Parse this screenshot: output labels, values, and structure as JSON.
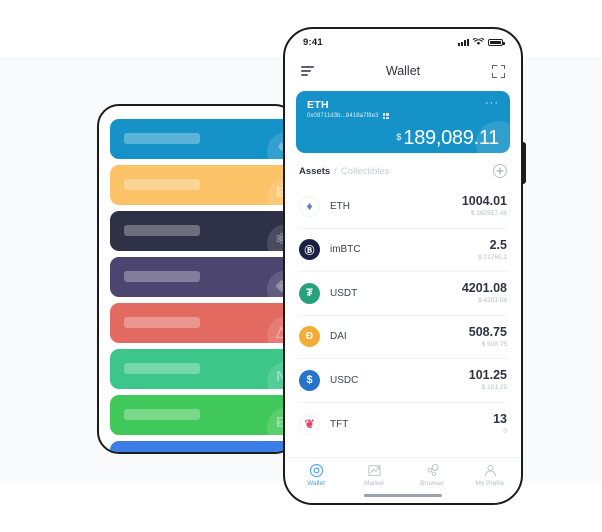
{
  "left_phone": {
    "name": "placeholder-wallet-list",
    "cards": [
      {
        "color": "#1592c8",
        "watermark_icon": "ethereum-icon",
        "glyph": "♦"
      },
      {
        "color": "#fbc267",
        "watermark_icon": "bitcoin-icon",
        "glyph": "Ƀ"
      },
      {
        "color": "#2f3147",
        "watermark_icon": "cosmos-icon",
        "glyph": "⚛"
      },
      {
        "color": "#4c4570",
        "watermark_icon": "eos-icon",
        "glyph": "◈"
      },
      {
        "color": "#e26a61",
        "watermark_icon": "tron-icon",
        "glyph": "△"
      },
      {
        "color": "#3cc68a",
        "watermark_icon": "nano-icon",
        "glyph": "N"
      },
      {
        "color": "#41c85a",
        "watermark_icon": "bch-icon",
        "glyph": "Ƀ"
      },
      {
        "color": "#3b7ee8",
        "watermark_icon": "litecoin-icon",
        "glyph": "Ł"
      }
    ]
  },
  "phone": {
    "status_bar": {
      "time": "9:41",
      "signal_icon": "cellular-bars-icon",
      "wifi_icon": "wifi-icon",
      "battery_icon": "battery-icon"
    },
    "appbar": {
      "menu_icon": "hamburger-menu-icon",
      "title": "Wallet",
      "scan_icon": "scan-qr-icon"
    },
    "balance_card": {
      "network": "ETH",
      "address": "0x08711d3b...8418a7f8e3",
      "qr_icon": "qr-code-icon",
      "more_icon": "more-options-icon",
      "currency_symbol": "$",
      "amount": "189,089.11",
      "accent_color": "#1592c8"
    },
    "assets_header": {
      "tab_assets": "Assets",
      "separator": "/",
      "tab_collectibles": "Collectibles",
      "add_icon": "plus-circle-icon"
    },
    "assets": [
      {
        "symbol": "ETH",
        "icon": "ethereum-coin-icon",
        "glyph": "♦",
        "class": "eth",
        "amount": "1004.01",
        "fiat": "$ 162517.48"
      },
      {
        "symbol": "imBTC",
        "icon": "imbtc-coin-icon",
        "glyph": "Ⓑ",
        "class": "imbtc",
        "amount": "2.5",
        "fiat": "$ 21760.1"
      },
      {
        "symbol": "USDT",
        "icon": "tether-coin-icon",
        "glyph": "₮",
        "class": "usdt",
        "amount": "4201.08",
        "fiat": "$ 4201.08"
      },
      {
        "symbol": "DAI",
        "icon": "dai-coin-icon",
        "glyph": "Đ",
        "class": "dai",
        "amount": "508.75",
        "fiat": "$ 508.75"
      },
      {
        "symbol": "USDC",
        "icon": "usdc-coin-icon",
        "glyph": "$",
        "class": "usdc",
        "amount": "101.25",
        "fiat": "$ 101.25"
      },
      {
        "symbol": "TFT",
        "icon": "tft-coin-icon",
        "glyph": "❦",
        "class": "tft",
        "amount": "13",
        "fiat": "0"
      }
    ],
    "tabbar": [
      {
        "label": "Wallet",
        "icon": "wallet-icon",
        "active": true
      },
      {
        "label": "Market",
        "icon": "market-icon",
        "active": false
      },
      {
        "label": "Browser",
        "icon": "browser-icon",
        "active": false
      },
      {
        "label": "My Profile",
        "icon": "profile-icon",
        "active": false
      }
    ],
    "active_tab_color": "#4a9ff5"
  }
}
